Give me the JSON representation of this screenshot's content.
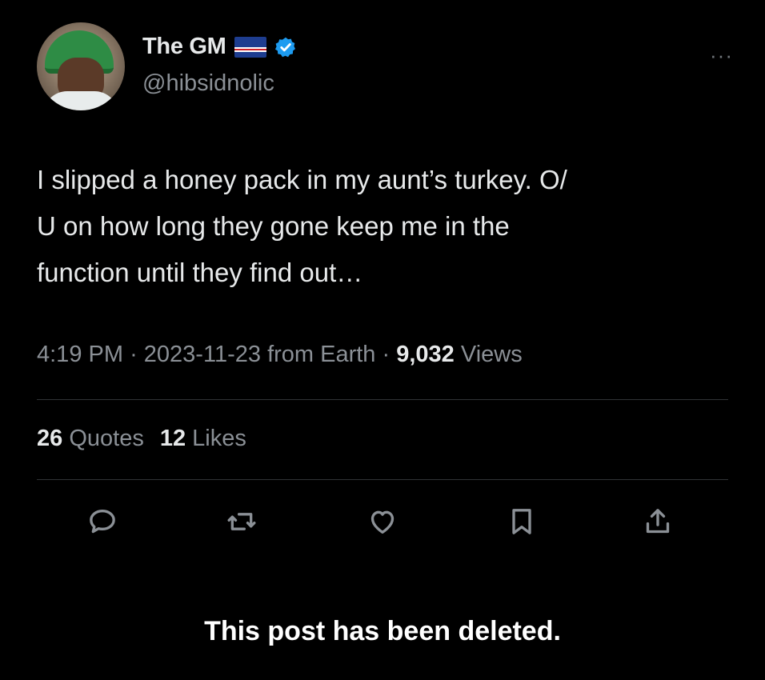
{
  "author": {
    "display_name": "The GM",
    "handle": "@hibsidnolic",
    "flag_icon": "cape-verde-flag-icon",
    "verified_icon": "verified-badge-icon",
    "verified_color": "#1d9bf0"
  },
  "more_label": "···",
  "tweet": {
    "text": "I slipped a honey pack in my aunt’s turkey. O/\nU on how long they gone keep me in the\nfunction until they find out…"
  },
  "meta": {
    "time": "4:19 PM",
    "separator": "·",
    "date": "2023-11-23",
    "source": "from Earth",
    "views_count": "9,032",
    "views_label": "Views"
  },
  "stats": {
    "quotes_count": "26",
    "quotes_label": "Quotes",
    "likes_count": "12",
    "likes_label": "Likes"
  },
  "actions": [
    "reply-icon",
    "retweet-icon",
    "like-icon",
    "bookmark-icon",
    "share-icon"
  ],
  "notice": "This post has been deleted.",
  "colors": {
    "background": "#000000",
    "primary_text": "#e7e9ea",
    "secondary_text": "#8b9096",
    "divider": "#2f3336"
  }
}
